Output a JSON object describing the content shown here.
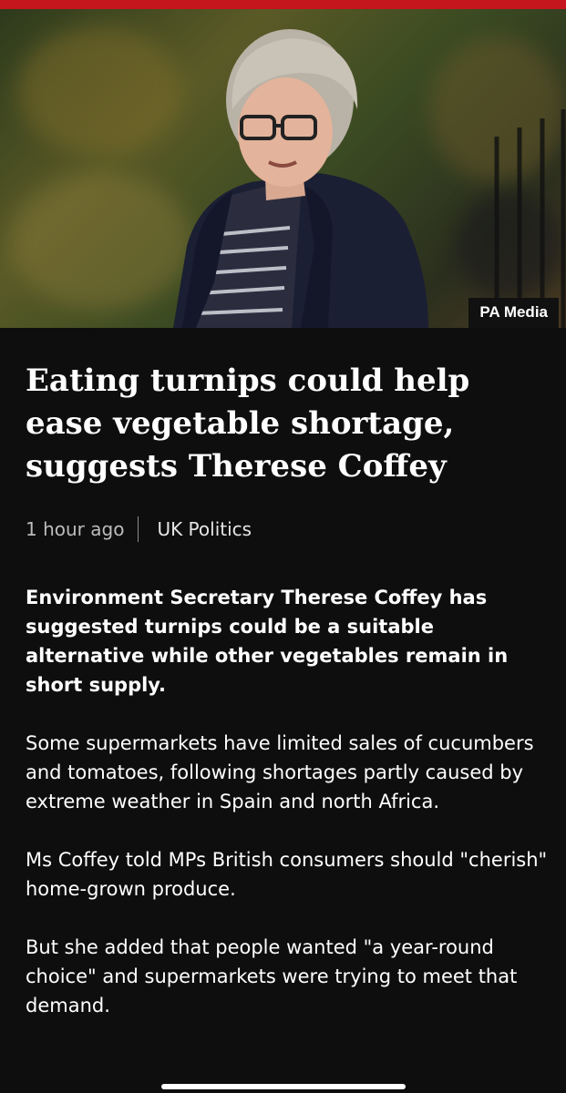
{
  "theme": {
    "accent": "#c4161c",
    "background": "#0e0e0e",
    "text": "#ffffff"
  },
  "hero": {
    "image_subject": "photo of a woman with glasses and a dark jacket",
    "credit": "PA Media"
  },
  "article": {
    "headline": "Eating turnips could help ease vegetable shortage, suggests Therese Coffey",
    "time": "1 hour ago",
    "topic": "UK Politics",
    "paragraphs": [
      "Environment Secretary Therese Coffey has suggested turnips could be a suitable alternative while other vegetables remain in short supply.",
      "Some supermarkets have limited sales of cucumbers and tomatoes, following shortages partly caused by extreme weather in Spain and north Africa.",
      "Ms Coffey told MPs British consumers should \"cherish\" home-grown produce.",
      "But she added that people wanted \"a year-round choice\" and supermarkets were trying to meet that demand."
    ]
  }
}
